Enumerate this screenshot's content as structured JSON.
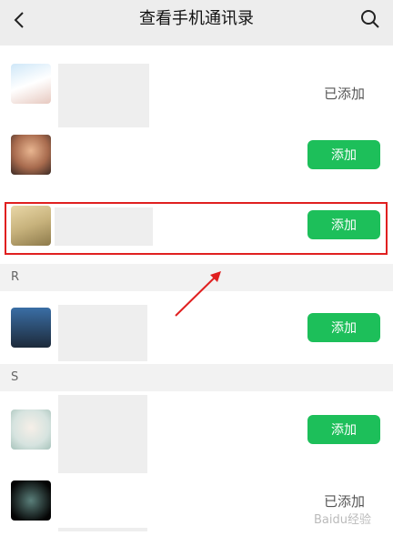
{
  "header": {
    "title": "查看手机通讯录",
    "back_icon": "back-chevron-icon",
    "search_icon": "search-icon"
  },
  "sections": {
    "r": "R",
    "s": "S"
  },
  "contacts": [
    {
      "status": "已添加"
    },
    {
      "button": "添加"
    },
    {
      "button": "添加",
      "highlighted": true
    },
    {
      "button": "添加"
    },
    {
      "button": "添加"
    },
    {
      "status": "已添加"
    }
  ],
  "watermark": "Baidu经验",
  "colors": {
    "accent_green": "#1dbf5a",
    "highlight_red": "#e02020",
    "header_bg": "#ededed"
  }
}
